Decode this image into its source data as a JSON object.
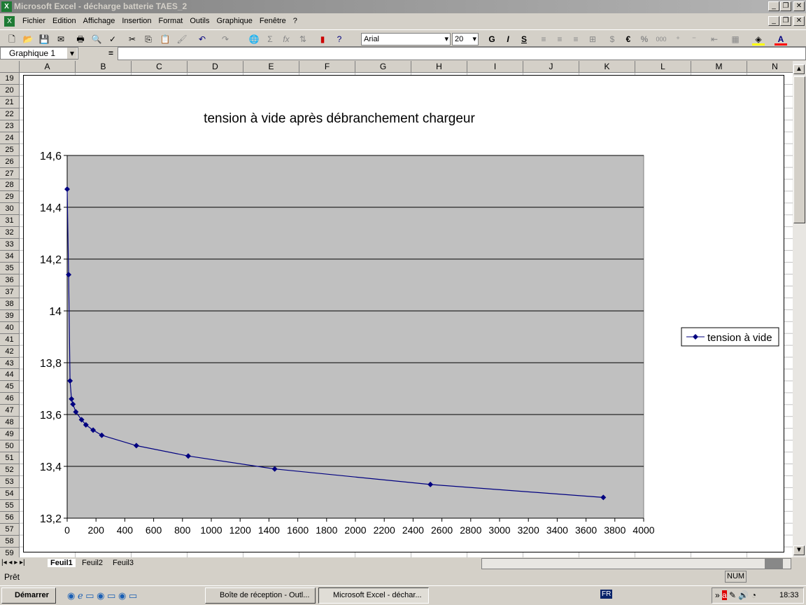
{
  "window": {
    "title": "Microsoft Excel - décharge batterie TAES_2"
  },
  "menu": [
    "Fichier",
    "Edition",
    "Affichage",
    "Insertion",
    "Format",
    "Outils",
    "Graphique",
    "Fenêtre",
    "?"
  ],
  "toolbar": {
    "font": "Arial",
    "size": "20",
    "bold": "G",
    "italic": "I",
    "underline": "S",
    "euro": "€",
    "percent": "%",
    "thousands": "000"
  },
  "formula": {
    "name_box": "Graphique 1",
    "equals": "="
  },
  "columns": [
    "A",
    "B",
    "C",
    "D",
    "E",
    "F",
    "G",
    "H",
    "I",
    "J",
    "K",
    "L",
    "M",
    "N"
  ],
  "rows": [
    19,
    20,
    21,
    22,
    23,
    24,
    25,
    26,
    27,
    28,
    29,
    30,
    31,
    32,
    33,
    34,
    35,
    36,
    37,
    38,
    39,
    40,
    41,
    42,
    43,
    44,
    45,
    46,
    47,
    48,
    49,
    50,
    51,
    52,
    53,
    54,
    55,
    56,
    57,
    58,
    59
  ],
  "sheets": [
    "Feuil1",
    "Feuil2",
    "Feuil3"
  ],
  "status": {
    "text": "Prêt",
    "num": "NUM"
  },
  "taskbar": {
    "start": "Démarrer",
    "tasks": [
      "Boîte de réception - Outl...",
      "Microsoft Excel - déchar..."
    ],
    "lang": "FR",
    "clock": "18:33"
  },
  "chart_data": {
    "type": "scatter-line",
    "title": "tension à vide après débranchement chargeur",
    "xlim": [
      0,
      4000
    ],
    "ylim": [
      13.2,
      14.6
    ],
    "xticks": [
      "0",
      "200",
      "400",
      "600",
      "800",
      "1000",
      "1200",
      "1400",
      "1600",
      "1800",
      "2000",
      "2200",
      "2400",
      "2600",
      "2800",
      "3000",
      "3200",
      "3400",
      "3600",
      "3800",
      "4000"
    ],
    "yticks": [
      "13,2",
      "13,4",
      "13,6",
      "13,8",
      "14",
      "14,2",
      "14,4",
      "14,6"
    ],
    "grid": "horizontal major",
    "legend": "right",
    "plot_bg": "#c0c0c0",
    "series_color": "#000080",
    "series": [
      {
        "name": "tension à vide",
        "x": [
          0,
          10,
          20,
          30,
          40,
          60,
          100,
          130,
          180,
          240,
          480,
          840,
          1440,
          2520,
          3720
        ],
        "y": [
          14.47,
          14.14,
          13.73,
          13.66,
          13.64,
          13.61,
          13.58,
          13.56,
          13.54,
          13.52,
          13.48,
          13.44,
          13.39,
          13.33,
          13.28
        ]
      }
    ]
  }
}
